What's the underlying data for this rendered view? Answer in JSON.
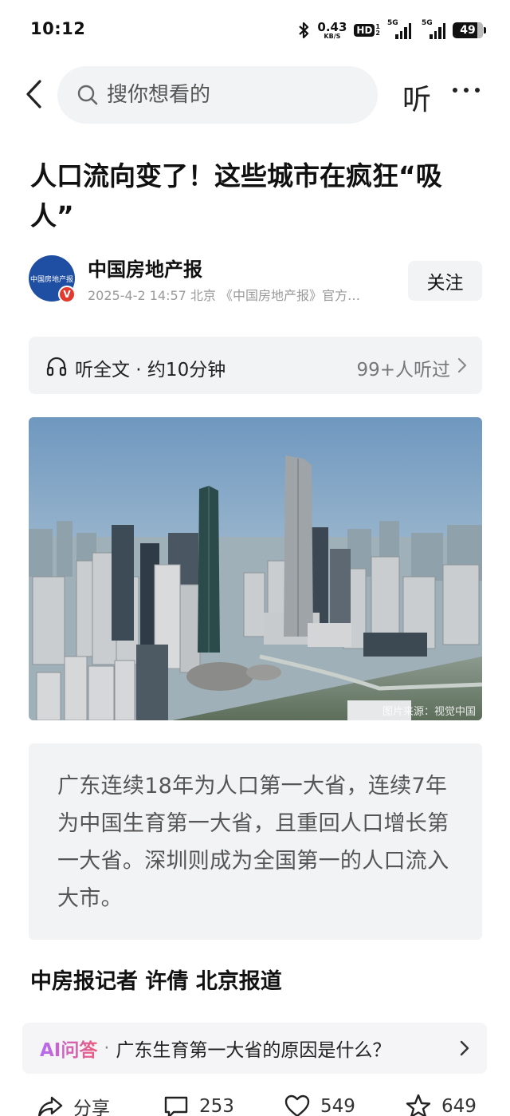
{
  "status_bar": {
    "time": "10:12",
    "net_speed": "0.43",
    "net_unit": "KB/S",
    "hd_label": "HD",
    "hd_sub_top": "1",
    "hd_sub_bottom": "2",
    "sim1_label": "5G",
    "sim2_label": "5G",
    "battery": "49",
    "icons": [
      "bluetooth-icon",
      "signal-icon",
      "battery-icon"
    ]
  },
  "nav": {
    "search_placeholder": "搜你想看的",
    "listen_label": "听",
    "icons": [
      "back-icon",
      "search-icon",
      "more-icon"
    ]
  },
  "article": {
    "title": "人口流向变了！这些城市在疯狂“吸人”",
    "author": {
      "name": "中国房地产报",
      "avatar_text": "中国房地产报",
      "verified_mark": "V",
      "meta": "2025-4-2  14:57  北京  《中国房地产报》官方…",
      "follow_label": "关注"
    },
    "listen_bar": {
      "label": "听全文 · 约10分钟",
      "listeners": "99+人听过"
    },
    "image_source": "图片来源：视觉中国",
    "summary": "广东连续18年为人口第一大省，连续7年为中国生育第一大省，且重回人口增长第一大省。深圳则成为全国第一的人口流入大市。",
    "byline": "中房报记者 许倩 北京报道",
    "ai": {
      "label": "AI问答",
      "separator": "·",
      "question": "广东生育第一大省的原因是什么？"
    }
  },
  "actions": {
    "share": "分享",
    "comments": "253",
    "likes": "549",
    "favorites": "649"
  },
  "colors": {
    "accent_ai_start": "#b46cf2",
    "accent_ai_end": "#ec5a7c",
    "verified_badge": "#e33a2f",
    "avatar_bg": "#1f4fa3",
    "panel_bg": "#f2f3f5"
  }
}
